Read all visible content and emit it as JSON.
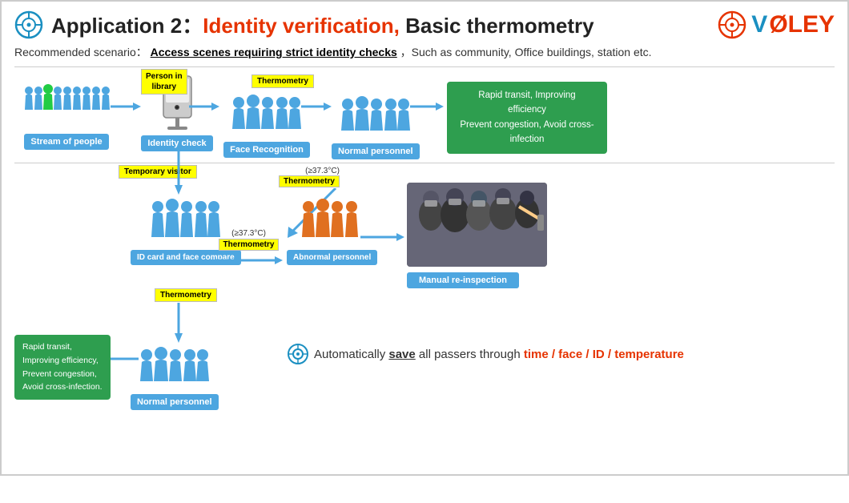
{
  "header": {
    "title_prefix": "Application 2：",
    "title_red": "Identity verification,",
    "title_suffix": " Basic thermometry",
    "logo": "VØLEY"
  },
  "scenario": {
    "label": "Recommended scenario：",
    "highlight": "Access scenes requiring strict identity checks",
    "rest": "，Such as community, Office buildings, station etc."
  },
  "top_flow": {
    "nodes": [
      {
        "label": "Stream of people"
      },
      {
        "label": "Identity check"
      },
      {
        "label": "Face Recognition"
      },
      {
        "label": "Normal personnel"
      }
    ],
    "badge_person_library": "Person in\nlibrary",
    "badge_thermometry_top": "Thermometry",
    "benefit_top": "Rapid transit, Improving efficiency\nPrevent congestion, Avoid cross-infection"
  },
  "bottom_flow": {
    "badge_temp_visitor": "Temporary visitor",
    "badge_thermometry_mid": "Thermometry",
    "badge_thermometry_low": "Thermometry",
    "temp_threshold_1": "(≥37.3°C)",
    "temp_threshold_2": "(≥37.3°C)",
    "node_id_compare": "ID card and\nface compare",
    "node_abnormal": "Abnormal\npersonnel",
    "node_normal_bottom": "Normal personnel",
    "node_reinspect": "Manual re-inspection",
    "benefit_bottom": "Rapid transit,\nImproving efficiency,\nPrevent congestion,\nAvoid cross-infection."
  },
  "save_line": {
    "prefix": "Automatically ",
    "save": "save",
    "middle": " all passers through ",
    "highlights": "time / face / ID / temperature"
  }
}
